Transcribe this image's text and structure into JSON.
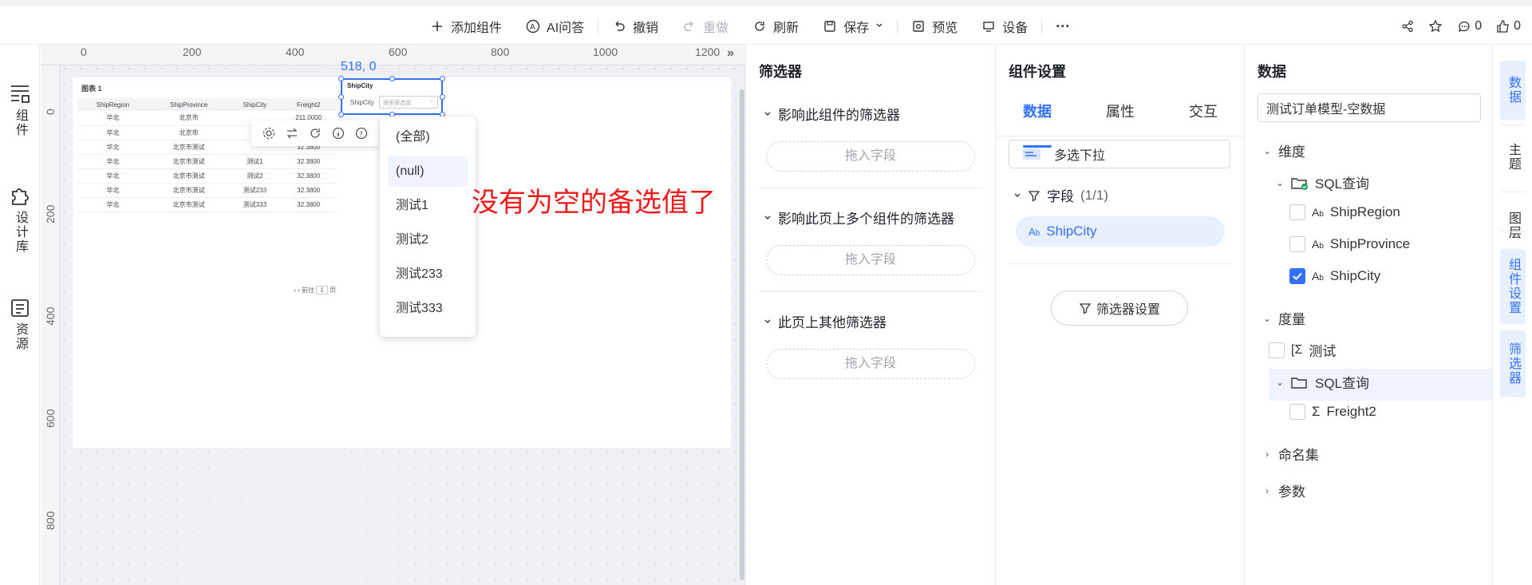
{
  "toolbar": {
    "add_component": "添加组件",
    "ai_qa": "AI问答",
    "undo": "撤销",
    "redo": "重做",
    "refresh": "刷新",
    "save": "保存",
    "preview": "预览",
    "device": "设备",
    "more": "···",
    "comment_count": "0",
    "like_count": "0"
  },
  "leftnav": {
    "components": "组件",
    "design_library": "设计库",
    "resources": "资源"
  },
  "ruler": {
    "h": [
      "0",
      "200",
      "400",
      "600",
      "800",
      "1000",
      "1200"
    ],
    "v": [
      "0",
      "200",
      "400",
      "600",
      "800"
    ]
  },
  "canvas": {
    "coord": "518, 0",
    "table_widget": {
      "title": "图表 1",
      "headers": [
        "ShipRegion",
        "ShipProvince",
        "ShipCity",
        "Freight2"
      ],
      "rows": [
        [
          "华北",
          "北京市",
          "",
          "211.0000"
        ],
        [
          "华北",
          "北京市",
          "",
          ""
        ],
        [
          "华北",
          "北京市测试",
          "",
          "32.3800"
        ],
        [
          "华北",
          "北京市测试",
          "测试1",
          "32.3800"
        ],
        [
          "华北",
          "北京市测试",
          "测试2",
          "32.3800"
        ],
        [
          "华北",
          "北京市测试",
          "测试233",
          "32.3800"
        ],
        [
          "华北",
          "北京市测试",
          "测试333",
          "32.3800"
        ]
      ],
      "footer_prev": "前往",
      "footer_page": "1",
      "footer_unit": "页"
    },
    "filter_widget": {
      "title": "ShipCity",
      "label": "ShipCity",
      "placeholder": "搜索筛选值"
    },
    "dropdown": [
      "(全部)",
      "(null)",
      "测试1",
      "测试2",
      "测试233",
      "测试333"
    ],
    "annotation": "没有为空的备选值了"
  },
  "filters_panel": {
    "title": "筛选器",
    "sections": [
      {
        "label": "影响此组件的筛选器",
        "drop": "拖入字段"
      },
      {
        "label": "影响此页上多个组件的筛选器",
        "drop": "拖入字段"
      },
      {
        "label": "此页上其他筛选器",
        "drop": "拖入字段"
      }
    ]
  },
  "component_settings": {
    "title": "组件设置",
    "tabs": [
      "数据",
      "属性",
      "交互"
    ],
    "widget_type": "多选下拉",
    "fields_label": "字段",
    "fields_count": "(1/1)",
    "field_chip": "ShipCity",
    "filter_settings": "筛选器设置"
  },
  "data_panel": {
    "title": "数据",
    "dataset": "测试订单模型-空数据",
    "dimensions": "维度",
    "sql_query": "SQL查询",
    "dim_fields": [
      {
        "name": "ShipRegion",
        "checked": false
      },
      {
        "name": "ShipProvince",
        "checked": false
      },
      {
        "name": "ShipCity",
        "checked": true
      }
    ],
    "measures": "度量",
    "measure_test": "测试",
    "sql_query2": "SQL查询",
    "measure_field": "Freight2",
    "named_sets": "命名集",
    "params": "参数"
  },
  "rightbar": [
    "数据",
    "主题",
    "图层",
    "组件设置",
    "筛选器"
  ],
  "colors": {
    "accent": "#3370ff",
    "annotation": "#f01a1a"
  }
}
